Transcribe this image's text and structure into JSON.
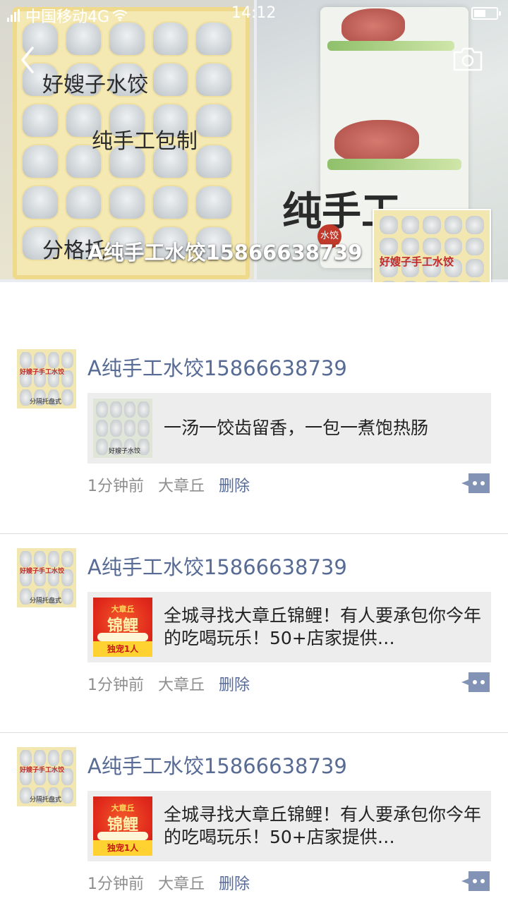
{
  "status_bar": {
    "carrier": "中国移动4G",
    "time": "14:12"
  },
  "cover": {
    "left_photo_lines": [
      "好嫂子水饺",
      "纯手工包制",
      "分格托"
    ],
    "right_photo_text": "纯手工",
    "right_photo_badge": "水饺",
    "profile_name": "A纯手工水饺15866638739"
  },
  "avatar": {
    "overlay_red_text": "好嫂子手工水饺",
    "overlay_caption": "分隔托盘式"
  },
  "posts": [
    {
      "author": "A纯手工水饺15866638739",
      "share_text": "一汤一饺齿留香，一包一煮饱热肠",
      "thumb_type": "dumpling",
      "thumb_caption": "好嫂子水饺",
      "time": "1分钟前",
      "location": "大章丘",
      "delete_label": "删除"
    },
    {
      "author": "A纯手工水饺15866638739",
      "share_text": "全城寻找大章丘锦鲤！有人要承包你今年的吃喝玩乐！50+店家提供…",
      "thumb_type": "koi",
      "thumb_top": "大章丘",
      "thumb_main": "锦鲤",
      "thumb_bottom": "独宠1人",
      "time": "1分钟前",
      "location": "大章丘",
      "delete_label": "删除"
    },
    {
      "author": "A纯手工水饺15866638739",
      "share_text": "全城寻找大章丘锦鲤！有人要承包你今年的吃喝玩乐！50+店家提供…",
      "thumb_type": "koi",
      "thumb_top": "大章丘",
      "thumb_main": "锦鲤",
      "thumb_bottom": "独宠1人",
      "time": "1分钟前",
      "location": "大章丘",
      "delete_label": "删除"
    }
  ],
  "colors": {
    "link_blue": "#576b95",
    "meta_gray": "#8e8e8e",
    "card_bg": "#ededed"
  },
  "icons": {
    "back": "chevron-left-icon",
    "camera": "camera-icon",
    "comment": "comment-dots-icon",
    "signal": "signal-icon",
    "wifi": "wifi-icon",
    "battery": "battery-icon"
  }
}
